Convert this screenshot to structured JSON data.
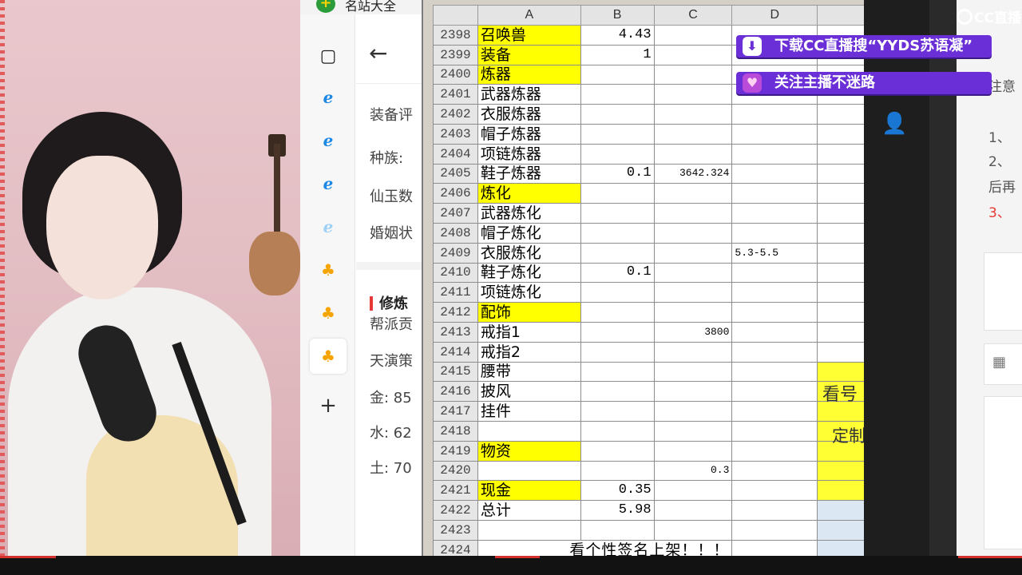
{
  "overlay": {
    "brand": "CC直播",
    "banner_download": "下载CC直播搜“YYDS苏语凝”",
    "banner_follow": "关注主播不迷路"
  },
  "browser": {
    "app_title": "名站大全",
    "content_lines": [
      "装备评",
      "种族:",
      "仙玉数",
      "婚姻状"
    ],
    "section_title": "修炼",
    "section_lines": [
      "帮派贡",
      "天演策",
      "金: 85",
      "水: 62",
      "土: 70"
    ],
    "tab_icons": [
      "tabs-icon",
      "edge-icon",
      "edge-icon",
      "edge-icon",
      "edge-icon",
      "chick-icon",
      "chick-icon",
      "chick-icon",
      "plus-icon"
    ]
  },
  "spreadsheet": {
    "columns": [
      "A",
      "B",
      "C",
      "D"
    ],
    "rows": [
      {
        "n": "2398",
        "a": "召唤兽",
        "a_hl": true,
        "b": "4.43",
        "c": "",
        "d": ""
      },
      {
        "n": "2399",
        "a": "装备",
        "a_hl": true,
        "b": "1",
        "c": "",
        "d": ""
      },
      {
        "n": "2400",
        "a": "炼器",
        "a_hl": true,
        "b": "",
        "c": "",
        "d": ""
      },
      {
        "n": "2401",
        "a": "武器炼器",
        "a_hl": false,
        "b": "",
        "c": "",
        "d": ""
      },
      {
        "n": "2402",
        "a": "衣服炼器",
        "a_hl": false,
        "b": "",
        "c": "",
        "d": ""
      },
      {
        "n": "2403",
        "a": "帽子炼器",
        "a_hl": false,
        "b": "",
        "c": "",
        "d": ""
      },
      {
        "n": "2404",
        "a": "项链炼器",
        "a_hl": false,
        "b": "",
        "c": "",
        "d": ""
      },
      {
        "n": "2405",
        "a": "鞋子炼器",
        "a_hl": false,
        "b": "0.1",
        "c": "3642.324",
        "d": ""
      },
      {
        "n": "2406",
        "a": "炼化",
        "a_hl": true,
        "b": "",
        "c": "",
        "d": ""
      },
      {
        "n": "2407",
        "a": "武器炼化",
        "a_hl": false,
        "b": "",
        "c": "",
        "d": ""
      },
      {
        "n": "2408",
        "a": "帽子炼化",
        "a_hl": false,
        "b": "",
        "c": "",
        "d": ""
      },
      {
        "n": "2409",
        "a": "衣服炼化",
        "a_hl": false,
        "b": "",
        "c": "",
        "d": "5.3-5.5"
      },
      {
        "n": "2410",
        "a": "鞋子炼化",
        "a_hl": false,
        "b": "0.1",
        "c": "",
        "d": ""
      },
      {
        "n": "2411",
        "a": "项链炼化",
        "a_hl": false,
        "b": "",
        "c": "",
        "d": ""
      },
      {
        "n": "2412",
        "a": "配饰",
        "a_hl": true,
        "b": "",
        "c": "",
        "d": ""
      },
      {
        "n": "2413",
        "a": "戒指1",
        "a_hl": false,
        "b": "",
        "c": "3800",
        "d": ""
      },
      {
        "n": "2414",
        "a": "戒指2",
        "a_hl": false,
        "b": "",
        "c": "",
        "d": ""
      },
      {
        "n": "2415",
        "a": "腰带",
        "a_hl": false,
        "b": "",
        "c": "",
        "d": ""
      },
      {
        "n": "2416",
        "a": "披风",
        "a_hl": false,
        "b": "",
        "c": "",
        "d": ""
      },
      {
        "n": "2417",
        "a": "挂件",
        "a_hl": false,
        "b": "",
        "c": "",
        "d": ""
      },
      {
        "n": "2418",
        "a": "",
        "a_hl": false,
        "b": "",
        "c": "",
        "d": ""
      },
      {
        "n": "2419",
        "a": "物资",
        "a_hl": true,
        "b": "",
        "c": "",
        "d": ""
      },
      {
        "n": "2420",
        "a": "",
        "a_hl": false,
        "b": "",
        "c": "0.3",
        "d": ""
      },
      {
        "n": "2421",
        "a": "现金",
        "a_hl": true,
        "b": "0.35",
        "c": "",
        "d": ""
      },
      {
        "n": "2422",
        "a": "总计",
        "a_hl": false,
        "b": "5.98",
        "c": "",
        "d": ""
      },
      {
        "n": "2423",
        "a": "",
        "a_hl": false,
        "b": "",
        "c": "",
        "d": ""
      }
    ],
    "last_row_number": "2424",
    "last_row_text": "看个性签名上架！！！",
    "side_label_1": "看号",
    "side_label_2": "定制"
  },
  "right_page": {
    "lines": [
      "注意",
      "1、",
      "2、",
      "后再",
      "3、"
    ]
  }
}
